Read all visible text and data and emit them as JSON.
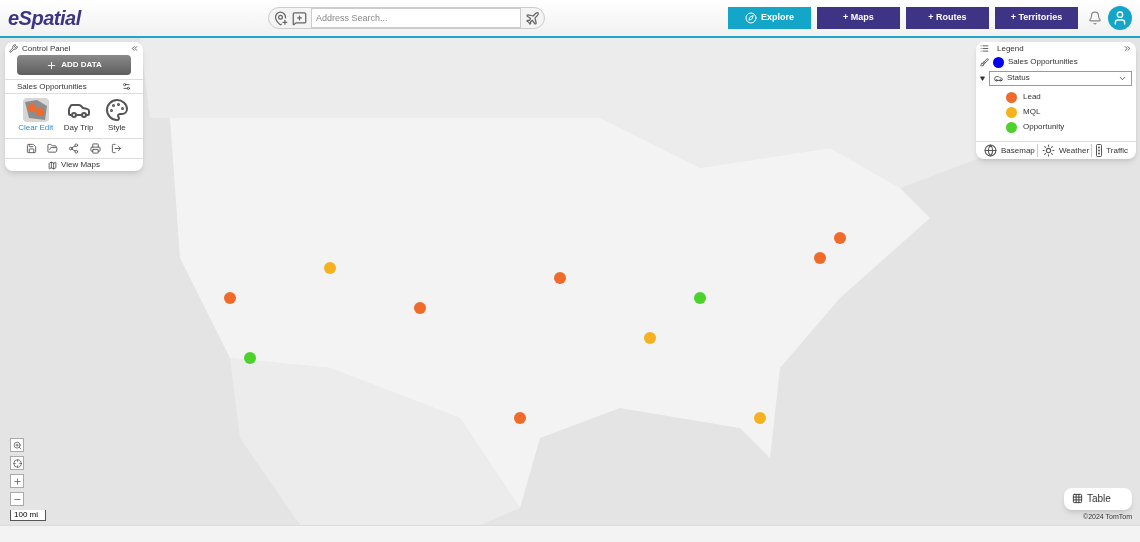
{
  "header": {
    "logo": "eSpatial",
    "search": {
      "placeholder": "Address Search..."
    },
    "nav": [
      {
        "label": "Explore",
        "kind": "primary"
      },
      {
        "label": "+ Maps",
        "kind": "secondary"
      },
      {
        "label": "+ Routes",
        "kind": "secondary"
      },
      {
        "label": "+ Territories",
        "kind": "secondary"
      }
    ]
  },
  "control_panel": {
    "title": "Control Panel",
    "add_button": "ADD DATA",
    "dataset": "Sales Opportunities",
    "tools": [
      {
        "label": "Clear Edit",
        "kind": "edit",
        "selected": true
      },
      {
        "label": "Day Trip",
        "kind": "car",
        "selected": false
      },
      {
        "label": "Style",
        "kind": "palette",
        "selected": false
      }
    ],
    "view_maps": "View Maps"
  },
  "legend": {
    "title": "Legend",
    "layer": {
      "name": "Sales Opportunities",
      "color": "#0000ee"
    },
    "group_by": "Status",
    "expanded": true,
    "items": [
      {
        "label": "Lead",
        "color": "#f06a2a"
      },
      {
        "label": "MQL",
        "color": "#f5b120"
      },
      {
        "label": "Opportunity",
        "color": "#4cd22a"
      }
    ],
    "footer": [
      {
        "label": "Basemap",
        "kind": "globe"
      },
      {
        "label": "Weather",
        "kind": "sun"
      },
      {
        "label": "Traffic",
        "kind": "traffic"
      }
    ]
  },
  "map": {
    "kind": "picture",
    "scale": "100 mi",
    "attribution": "©2024 TomTom"
  },
  "table_button": "Table"
}
